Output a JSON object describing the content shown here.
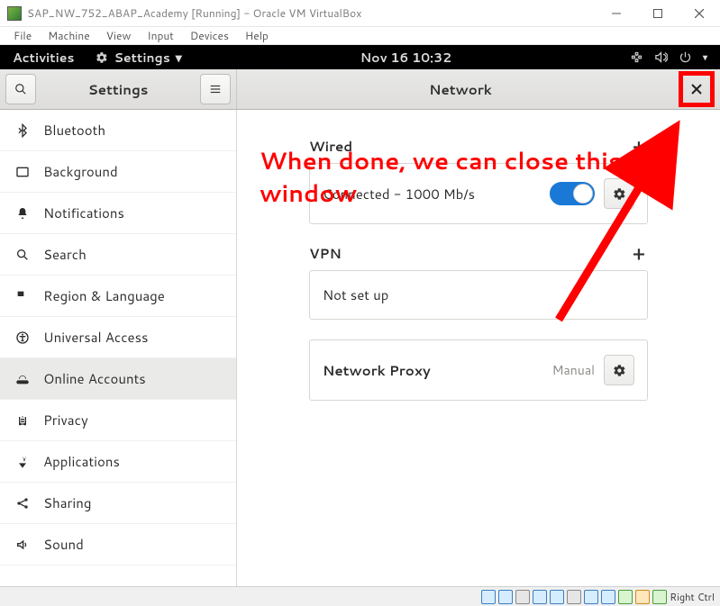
{
  "virtualbox": {
    "title": "SAP_NW_752_ABAP_Academy [Running] - Oracle VM VirtualBox",
    "menu": [
      "File",
      "Machine",
      "View",
      "Input",
      "Devices",
      "Help"
    ],
    "host_key": "Right Ctrl"
  },
  "gnome_panel": {
    "activities": "Activities",
    "appmenu": "Settings",
    "clock": "Nov 16  10:32"
  },
  "settings_app": {
    "left_title": "Settings",
    "right_title": "Network",
    "sidebar": [
      {
        "id": "bluetooth",
        "label": "Bluetooth"
      },
      {
        "id": "background",
        "label": "Background"
      },
      {
        "id": "notifications",
        "label": "Notifications"
      },
      {
        "id": "search",
        "label": "Search"
      },
      {
        "id": "region",
        "label": "Region & Language"
      },
      {
        "id": "universal",
        "label": "Universal Access"
      },
      {
        "id": "online",
        "label": "Online Accounts"
      },
      {
        "id": "privacy",
        "label": "Privacy"
      },
      {
        "id": "applications",
        "label": "Applications"
      },
      {
        "id": "sharing",
        "label": "Sharing"
      },
      {
        "id": "sound",
        "label": "Sound"
      }
    ],
    "selected_sidebar_index": 6,
    "network": {
      "wired_heading": "Wired",
      "wired_status": "Connected - 1000 Mb/s",
      "wired_on": true,
      "vpn_heading": "VPN",
      "vpn_status": "Not set up",
      "proxy_label": "Network Proxy",
      "proxy_mode": "Manual"
    }
  },
  "annotation": {
    "text": "When done, we can close this window"
  }
}
